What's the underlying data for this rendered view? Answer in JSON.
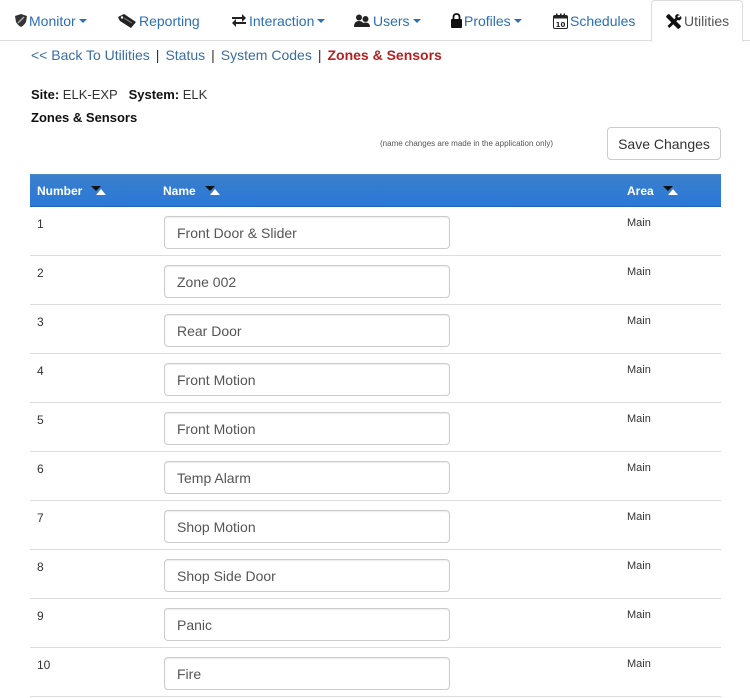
{
  "nav": {
    "items": [
      {
        "label": "Monitor",
        "icon": "shield-icon",
        "dropdown": true
      },
      {
        "label": "Reporting",
        "icon": "tag-icon",
        "dropdown": false
      },
      {
        "label": "Interaction",
        "icon": "exchange-icon",
        "dropdown": true
      },
      {
        "label": "Users",
        "icon": "users-icon",
        "dropdown": true
      },
      {
        "label": "Profiles",
        "icon": "lock-icon",
        "dropdown": true
      },
      {
        "label": "Schedules",
        "icon": "calendar-icon",
        "dropdown": false
      },
      {
        "label": "Utilities",
        "icon": "tools-icon",
        "dropdown": false,
        "active": true
      }
    ]
  },
  "breadcrumb": {
    "back": "<< Back To Utilities",
    "status": "Status",
    "system_codes": "System Codes",
    "current": "Zones & Sensors",
    "separator": "|"
  },
  "site": {
    "site_label": "Site:",
    "site_value": "ELK-EXP",
    "system_label": "System:",
    "system_value": "ELK"
  },
  "section_title": "Zones & Sensors",
  "note": "(name changes are made in the application only)",
  "save_label": "Save Changes",
  "colors": {
    "link": "#2a6fb6",
    "current_crumb": "#b22222",
    "header_bg": "#2a78d8"
  },
  "table": {
    "headers": {
      "number": "Number",
      "name": "Name",
      "area": "Area"
    },
    "rows": [
      {
        "number": "1",
        "name": "Front Door & Slider",
        "area": "Main"
      },
      {
        "number": "2",
        "name": "Zone 002",
        "area": "Main"
      },
      {
        "number": "3",
        "name": "Rear Door",
        "area": "Main"
      },
      {
        "number": "4",
        "name": "Front Motion",
        "area": "Main"
      },
      {
        "number": "5",
        "name": "Front Motion",
        "area": "Main"
      },
      {
        "number": "6",
        "name": "Temp Alarm",
        "area": "Main"
      },
      {
        "number": "7",
        "name": "Shop Motion",
        "area": "Main"
      },
      {
        "number": "8",
        "name": "Shop Side Door",
        "area": "Main"
      },
      {
        "number": "9",
        "name": "Panic",
        "area": "Main"
      },
      {
        "number": "10",
        "name": "Fire",
        "area": "Main"
      }
    ]
  }
}
